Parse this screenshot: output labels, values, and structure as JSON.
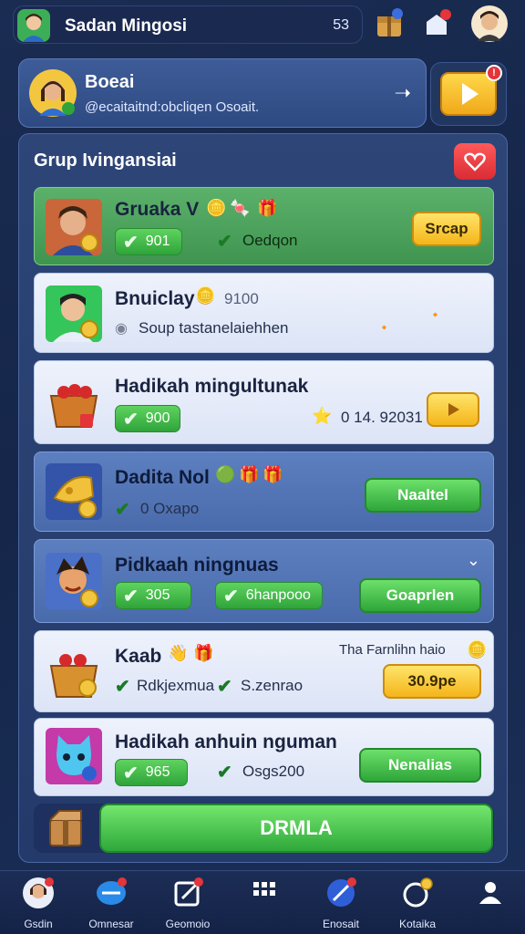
{
  "topbar": {
    "username": "Sadan Mingosi",
    "count": "53"
  },
  "profile": {
    "name": "Boeai",
    "status": "@ecaitaitnd:obcliqen Osoait."
  },
  "panel": {
    "title": "Grup Ivingansiai"
  },
  "rows": [
    {
      "title": "Gruaka V",
      "pill": "901",
      "sub": "Oedqon",
      "button": "Srcap"
    },
    {
      "title": "Bnuiclay",
      "extra": "9100",
      "sub": "Soup tastanelaiehhen"
    },
    {
      "title": "Hadikah mingultunak",
      "pill": "900",
      "sub": "0 14. 92031"
    },
    {
      "title": "Dadita Nol",
      "sub": "0 Oxapo",
      "button": "Naaltel"
    },
    {
      "title": "Pidkaah ningnuas",
      "pill": "305",
      "pill2": "6hanpooo",
      "button": "Goaprlen"
    },
    {
      "title": "Kaab",
      "sub": "Rdkjexmua",
      "sub2": "S.zenrao",
      "note": "Tha Farnlihn haio",
      "button": "30.9pe"
    },
    {
      "title": "Hadikah anhuin nguman",
      "pill": "965",
      "sub": "Osgs200",
      "button": "Nenalias"
    }
  ],
  "bigbutton": "DRMLA",
  "nav": [
    {
      "label": "Gsdin"
    },
    {
      "label": "Omnesar"
    },
    {
      "label": "Geomoio"
    },
    {
      "label": ""
    },
    {
      "label": "Enosait"
    },
    {
      "label": "Kotaika"
    },
    {
      "label": ""
    }
  ],
  "colors": {
    "background": "#1b2c52",
    "green": "#2fa43a",
    "yellow": "#f4b51a",
    "red": "#e3353a"
  }
}
